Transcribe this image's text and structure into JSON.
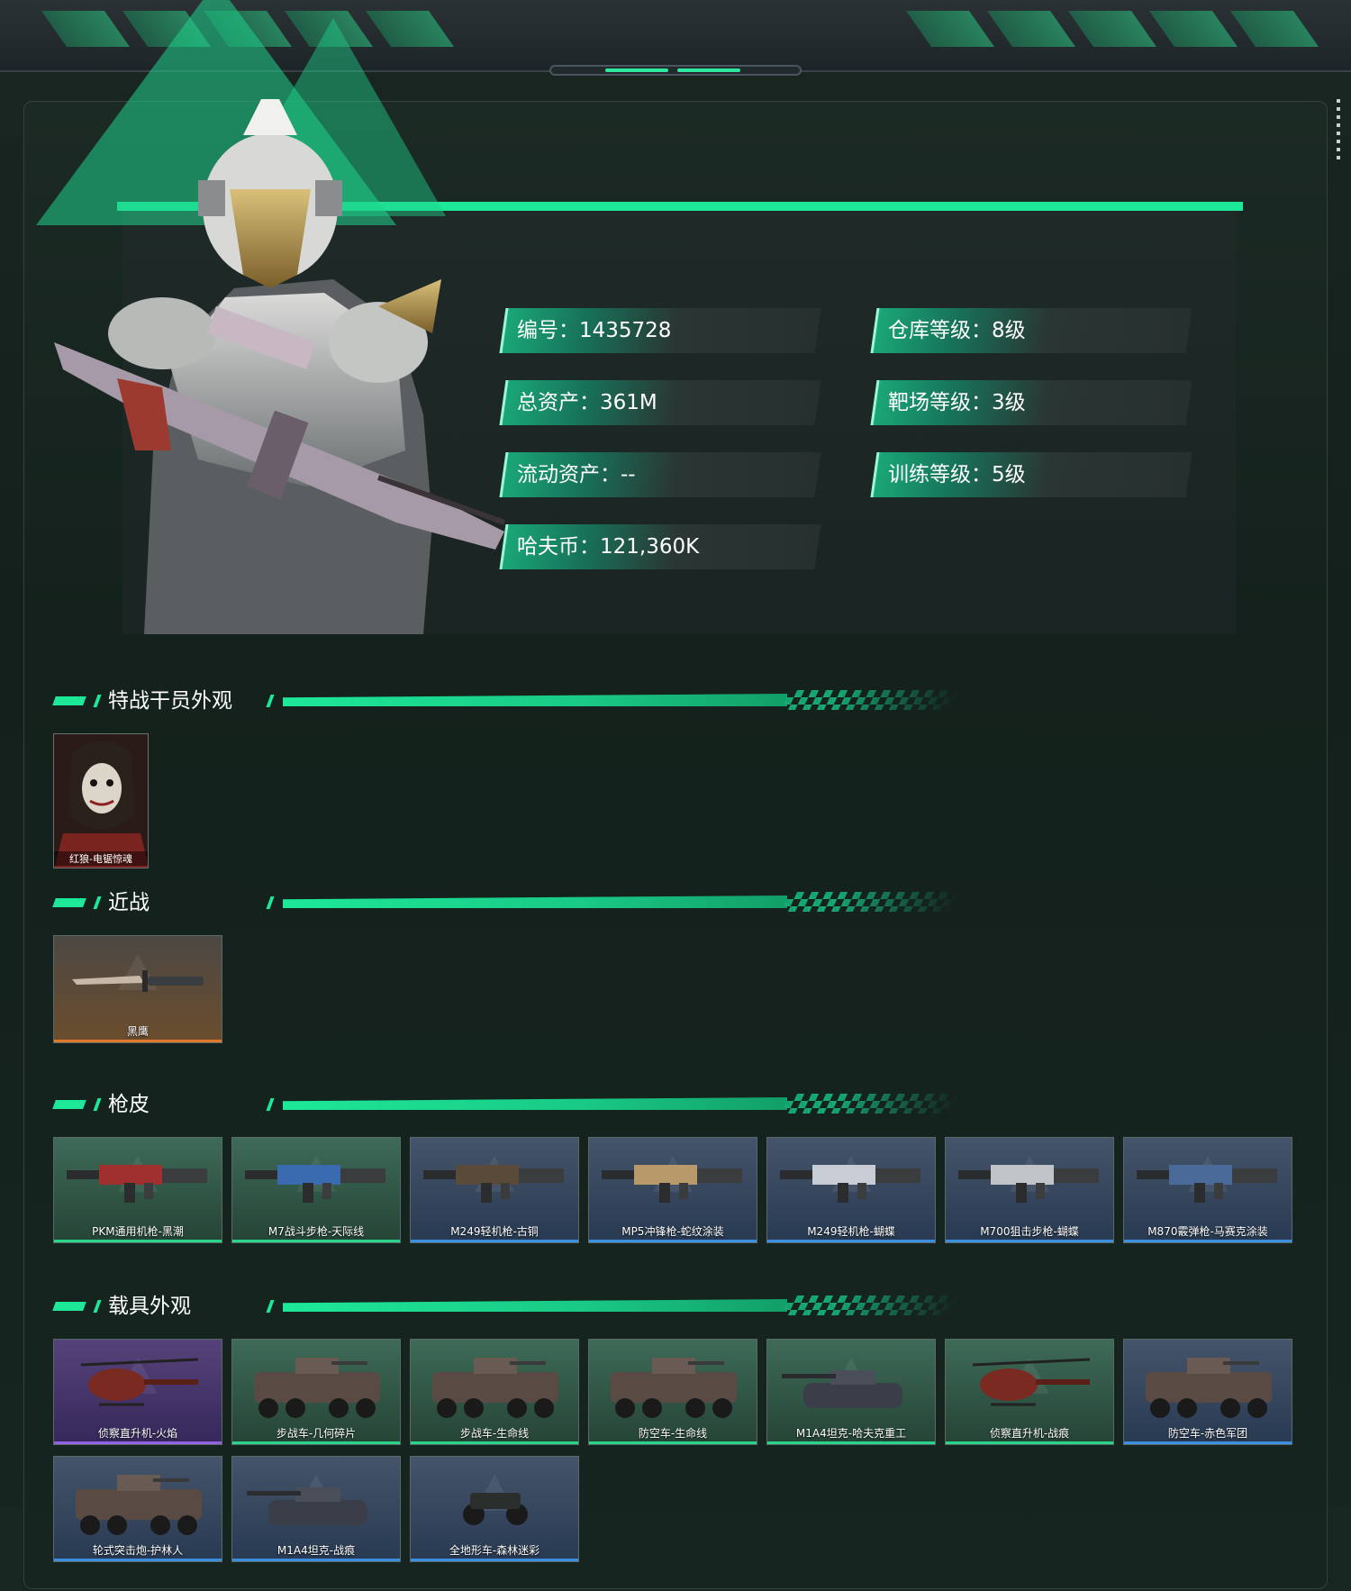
{
  "stats": {
    "id": "编号：1435728",
    "total_assets": "总资产：361M",
    "liquid_assets": "流动资产：--",
    "haf_coin": "哈夫币：121,360K",
    "warehouse_level": "仓库等级：8级",
    "range_level": "靶场等级：3级",
    "training_level": "训练等级：5级"
  },
  "sections": {
    "operator": "特战干员外观",
    "melee": "近战",
    "weapon_skins": "枪皮",
    "vehicles": "载具外观"
  },
  "operator_skins": [
    {
      "label": "红狼-电锯惊魂"
    }
  ],
  "melee_items": [
    {
      "label": "黑鹰",
      "rarity": "orange"
    }
  ],
  "weapon_skins": [
    {
      "label": "PKM通用机枪-黑潮",
      "rarity": "green"
    },
    {
      "label": "M7战斗步枪-天际线",
      "rarity": "green"
    },
    {
      "label": "M249轻机枪-古铜",
      "rarity": "blue"
    },
    {
      "label": "MP5冲锋枪-蛇纹涂装",
      "rarity": "blue"
    },
    {
      "label": "M249轻机枪-蝴蝶",
      "rarity": "blue"
    },
    {
      "label": "M700狙击步枪-蝴蝶",
      "rarity": "blue"
    },
    {
      "label": "M870霰弹枪-马赛克涂装",
      "rarity": "blue"
    }
  ],
  "vehicle_skins": [
    {
      "label": "侦察直升机-火焰",
      "rarity": "purple"
    },
    {
      "label": "步战车-几何碎片",
      "rarity": "green"
    },
    {
      "label": "步战车-生命线",
      "rarity": "green"
    },
    {
      "label": "防空车-生命线",
      "rarity": "green"
    },
    {
      "label": "M1A4坦克-哈夫克重工",
      "rarity": "green"
    },
    {
      "label": "侦察直升机-战痕",
      "rarity": "green"
    },
    {
      "label": "防空车-赤色军团",
      "rarity": "blue"
    },
    {
      "label": "轮式突击炮-护林人",
      "rarity": "blue"
    },
    {
      "label": "M1A4坦克-战痕",
      "rarity": "blue"
    },
    {
      "label": "全地形车-森林迷彩",
      "rarity": "blue"
    }
  ],
  "colors": {
    "accent": "#1de89a",
    "rarity_green": "#28d58a",
    "rarity_blue": "#3c8ee0",
    "rarity_purple": "#9360e6",
    "rarity_orange": "#e07a2a"
  }
}
